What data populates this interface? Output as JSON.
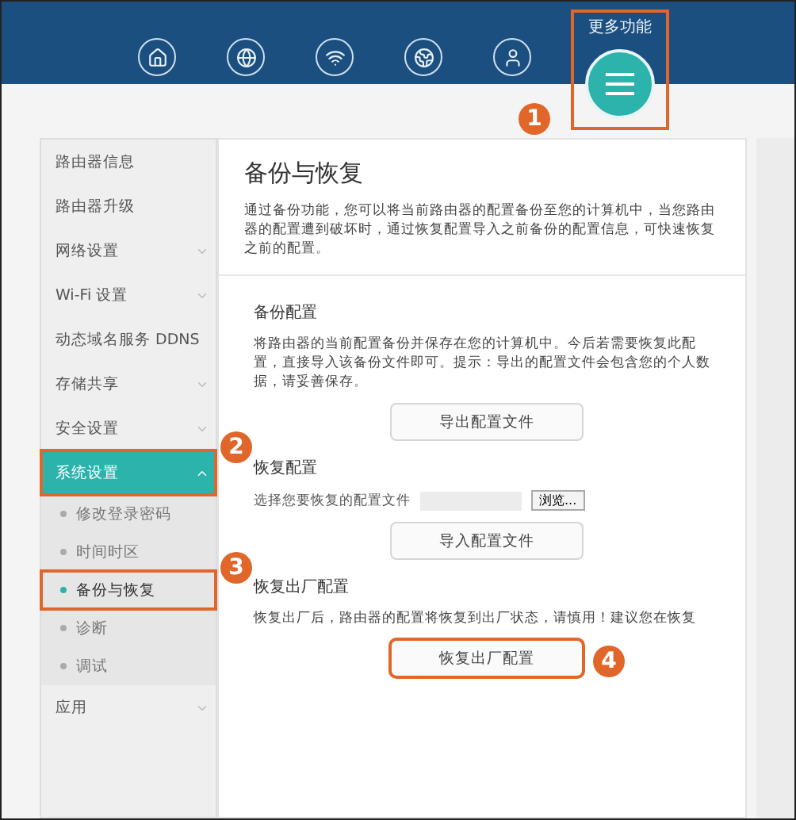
{
  "header": {
    "nav": [
      {
        "kind": "home"
      },
      {
        "kind": "globe"
      },
      {
        "kind": "wifi"
      },
      {
        "kind": "network"
      },
      {
        "kind": "user"
      }
    ],
    "more": {
      "label": "更多功能",
      "highlighted": true,
      "callout": "1"
    }
  },
  "sidebar": {
    "items": [
      {
        "label": "路由器信息",
        "has_submenu": false,
        "selected": false,
        "highlighted": false
      },
      {
        "label": "路由器升级",
        "has_submenu": false,
        "selected": false,
        "highlighted": false
      },
      {
        "label": "网络设置",
        "has_submenu": true,
        "selected": false,
        "highlighted": false
      },
      {
        "label": "Wi-Fi 设置",
        "has_submenu": true,
        "selected": false,
        "highlighted": false
      },
      {
        "label": "动态域名服务 DDNS",
        "has_submenu": false,
        "selected": false,
        "highlighted": false
      },
      {
        "label": "存储共享",
        "has_submenu": true,
        "selected": false,
        "highlighted": false
      },
      {
        "label": "安全设置",
        "has_submenu": true,
        "selected": false,
        "highlighted": false
      },
      {
        "label": "系统设置",
        "has_submenu": true,
        "selected": true,
        "expanded": true,
        "highlighted": true,
        "callout": "2",
        "children": [
          {
            "label": "修改登录密码",
            "selected": false,
            "highlighted": false
          },
          {
            "label": "时间时区",
            "selected": false,
            "highlighted": false
          },
          {
            "label": "备份与恢复",
            "selected": true,
            "highlighted": true,
            "callout": "3"
          },
          {
            "label": "诊断",
            "selected": false,
            "highlighted": false
          },
          {
            "label": "调试",
            "selected": false,
            "highlighted": false
          }
        ]
      },
      {
        "label": "应用",
        "has_submenu": true,
        "selected": false,
        "highlighted": false
      }
    ]
  },
  "page": {
    "title": "备份与恢复",
    "description": "通过备份功能，您可以将当前路由器的配置备份至您的计算机中，当您路由器的配置遭到破坏时，通过恢复配置导入之前备份的配置信息，可快速恢复之前的配置。",
    "sections": [
      {
        "kind": "backup",
        "title": "备份配置",
        "text": "将路由器的当前配置备份并保存在您的计算机中。今后若需要恢复此配置，直接导入该备份文件即可。提示：导出的配置文件会包含您的个人数据，请妥善保存。",
        "button": {
          "label": "导出配置文件",
          "highlighted": false
        }
      },
      {
        "kind": "restore",
        "title": "恢复配置",
        "file_label": "选择您要恢复的配置文件",
        "browse": "浏览...",
        "button": {
          "label": "导入配置文件",
          "highlighted": false
        }
      },
      {
        "kind": "reset",
        "title": "恢复出厂配置",
        "text": "恢复出厂后，路由器的配置将恢复到出厂状态，请慎用！建议您在恢复",
        "button": {
          "label": "恢复出厂配置",
          "highlighted": true,
          "callout": "4"
        }
      }
    ]
  }
}
